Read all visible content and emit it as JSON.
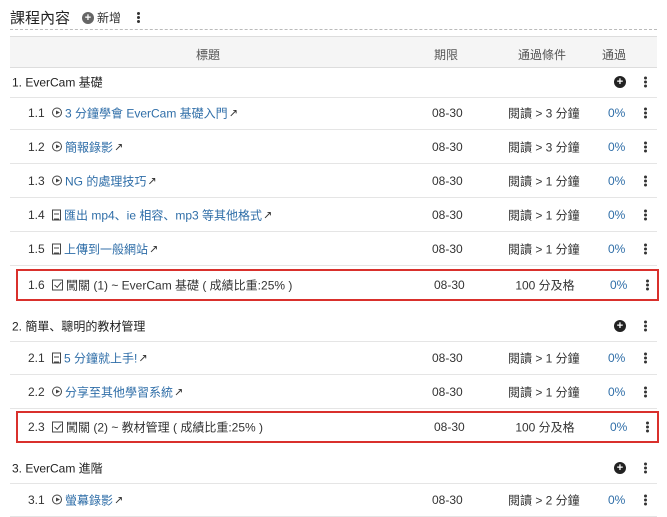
{
  "header": {
    "title": "課程內容",
    "add_label": "新增"
  },
  "table": {
    "col_title": "標題",
    "col_deadline": "期限",
    "col_condition": "通過條件",
    "col_pass": "通過"
  },
  "rows": [
    {
      "kind": "section",
      "title": "1. EverCam 基礎"
    },
    {
      "kind": "item",
      "num": "1.1",
      "icon": "play-icon",
      "title": "3 分鐘學會 EverCam 基礎入門",
      "deadline": "08-30",
      "condition": "閱讀 > 3 分鐘",
      "pass": "0%"
    },
    {
      "kind": "item",
      "num": "1.2",
      "icon": "play-icon",
      "title": "簡報錄影",
      "deadline": "08-30",
      "condition": "閱讀 > 3 分鐘",
      "pass": "0%"
    },
    {
      "kind": "item",
      "num": "1.3",
      "icon": "play-icon",
      "title": "NG 的處理技巧",
      "deadline": "08-30",
      "condition": "閱讀 > 1 分鐘",
      "pass": "0%"
    },
    {
      "kind": "item",
      "num": "1.4",
      "icon": "doc-icon",
      "title": "匯出 mp4、ie 相容、mp3 等其他格式",
      "deadline": "08-30",
      "condition": "閱讀 > 1 分鐘",
      "pass": "0%"
    },
    {
      "kind": "item",
      "num": "1.5",
      "icon": "doc-icon",
      "title": "上傳到一般網站",
      "deadline": "08-30",
      "condition": "閱讀 > 1 分鐘",
      "pass": "0%"
    },
    {
      "kind": "exam",
      "num": "1.6",
      "icon": "check-icon",
      "title": "闖關 (1) ~ EverCam 基礎 ( 成績比重:25% )",
      "deadline": "08-30",
      "condition": "100 分及格",
      "pass": "0%"
    },
    {
      "kind": "section",
      "title": "2. 簡單、聰明的教材管理"
    },
    {
      "kind": "item",
      "num": "2.1",
      "icon": "doc-icon",
      "title": "5 分鐘就上手!",
      "deadline": "08-30",
      "condition": "閱讀 > 1 分鐘",
      "pass": "0%"
    },
    {
      "kind": "item",
      "num": "2.2",
      "icon": "play-icon",
      "title": "分享至其他學習系統",
      "deadline": "08-30",
      "condition": "閱讀 > 1 分鐘",
      "pass": "0%"
    },
    {
      "kind": "exam",
      "num": "2.3",
      "icon": "check-icon",
      "title": "闖關 (2) ~ 教材管理 ( 成績比重:25% )",
      "deadline": "08-30",
      "condition": "100 分及格",
      "pass": "0%"
    },
    {
      "kind": "section",
      "title": "3. EverCam 進階"
    },
    {
      "kind": "item",
      "num": "3.1",
      "icon": "play-icon",
      "title": "螢幕錄影",
      "deadline": "08-30",
      "condition": "閱讀 > 2 分鐘",
      "pass": "0%"
    }
  ]
}
